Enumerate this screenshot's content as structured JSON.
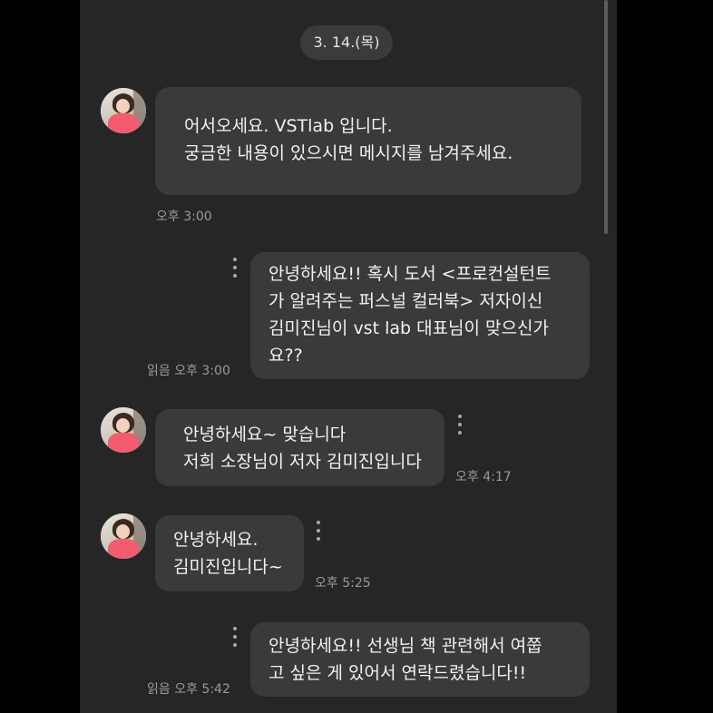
{
  "chat": {
    "date_divider": "3. 14.(목)",
    "messages": [
      {
        "sender": "incoming",
        "lines": [
          "어서오세요. VSTlab 입니다.",
          "궁금한 내용이 있으시면 메시지를 남겨주세요."
        ],
        "time": "오후 3:00"
      },
      {
        "sender": "outgoing",
        "lines": [
          "안녕하세요!! 혹시 도서 <프로컨설턴트",
          "가 알려주는 퍼스널 컬러북> 저자이신",
          "김미진님이 vst lab 대표님이 맞으신가",
          "요??"
        ],
        "time": "읽음 오후 3:00"
      },
      {
        "sender": "incoming",
        "lines": [
          "안녕하세요~ 맞습니다",
          "저희 소장님이 저자 김미진입니다"
        ],
        "time": "오후 4:17"
      },
      {
        "sender": "incoming",
        "lines": [
          "안녕하세요.",
          "김미진입니다~"
        ],
        "time": "오후 5:25"
      },
      {
        "sender": "outgoing",
        "lines": [
          "안녕하세요!! 선생님 책 관련해서 여쭙",
          "고 싶은 게 있어서 연락드렸습니다!!"
        ],
        "time": "읽음 오후 5:42"
      }
    ]
  },
  "icons": {
    "avatar": "profile-avatar",
    "more": "more-vertical-icon"
  },
  "colors": {
    "page": "#000000",
    "chat_background": "#262626",
    "bubble": "#3a3a3a",
    "date_pill": "#3b3b3b",
    "text": "#f2f2f2",
    "timestamp": "#9a9a9a"
  }
}
